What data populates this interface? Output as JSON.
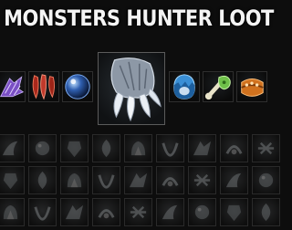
{
  "header": {
    "title": "MONSTERS HUNTER LOOT"
  },
  "featured_loot": [
    {
      "icon": "purple-wing-icon",
      "color": "#7a4fc4"
    },
    {
      "icon": "red-claw-icon",
      "color": "#c0392b"
    },
    {
      "icon": "blue-orb-icon",
      "color": "#2f5fb0"
    },
    {
      "icon": "gray-claw-icon",
      "color": "#aeb8c4",
      "selected": true
    },
    {
      "icon": "cracked-egg-icon",
      "color": "#3a8fd6"
    },
    {
      "icon": "green-bone-icon",
      "color": "#6fc04a"
    },
    {
      "icon": "orange-bracer-icon",
      "color": "#d0711e"
    }
  ],
  "inventory_rows": 3,
  "inventory_columns": 9
}
